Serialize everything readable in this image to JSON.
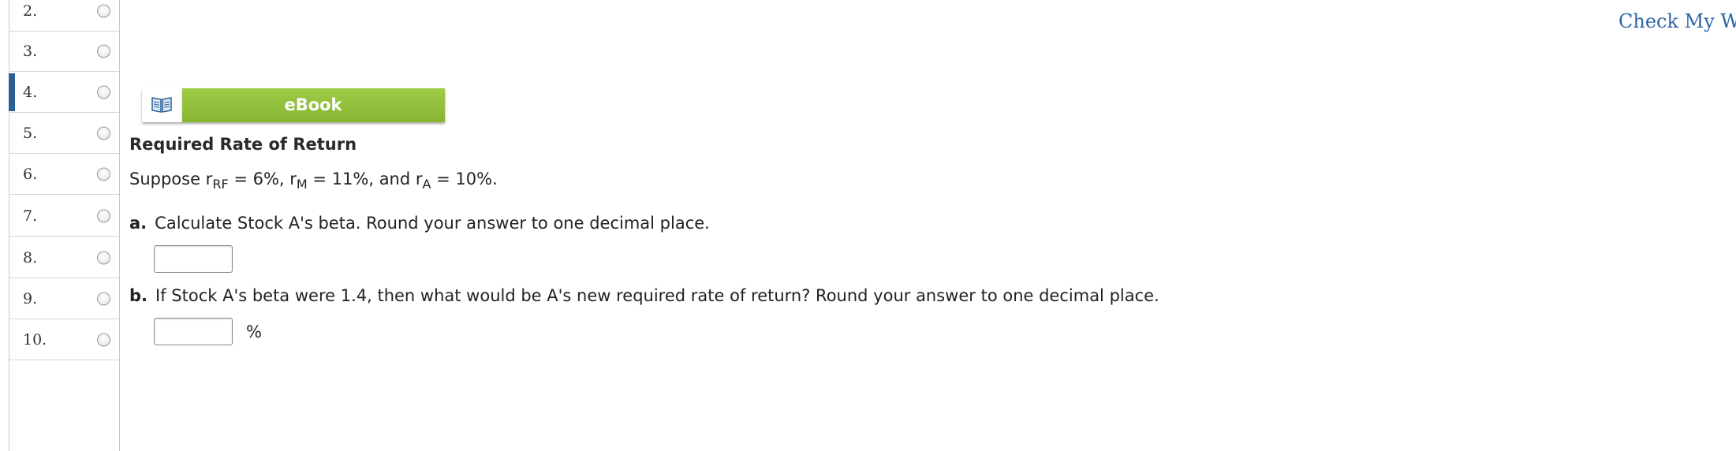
{
  "nav": {
    "items": [
      {
        "num": "2.",
        "current": false
      },
      {
        "num": "3.",
        "current": false
      },
      {
        "num": "4.",
        "current": true
      },
      {
        "num": "5.",
        "current": false
      },
      {
        "num": "6.",
        "current": false
      },
      {
        "num": "7.",
        "current": false
      },
      {
        "num": "8.",
        "current": false
      },
      {
        "num": "9.",
        "current": false
      },
      {
        "num": "10.",
        "current": false
      }
    ]
  },
  "header": {
    "check_link": "Check My Wo"
  },
  "ebook": {
    "label": "eBook",
    "icon": "book-icon"
  },
  "problem": {
    "title": "Required Rate of Return",
    "premise": {
      "suppose": "Suppose r",
      "rf_sub": "RF",
      "rf_rest": " = 6%, r",
      "m_sub": "M",
      "m_rest": " = 11%, and r",
      "a_sub": "A",
      "a_rest": " = 10%."
    },
    "part_a": {
      "label": "a.",
      "text": "Calculate Stock A's beta. Round your answer to one decimal place.",
      "value": ""
    },
    "part_b": {
      "label": "b.",
      "text": "If Stock A's beta were 1.4, then what would be A's new required rate of return? Round your answer to one decimal place.",
      "value": "",
      "unit": "%"
    }
  },
  "colors": {
    "accent": "#2b5f95",
    "ebook_green": "#8fbe3a",
    "link": "#2d64a8"
  }
}
